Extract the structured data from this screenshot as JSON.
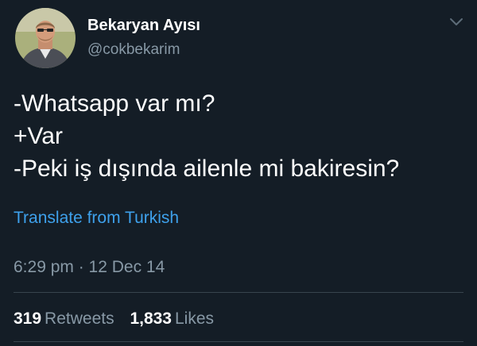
{
  "tweet": {
    "author": {
      "display_name": "Bekaryan Ayısı",
      "handle": "@cokbekarim"
    },
    "text_lines": [
      "-Whatsapp var mı?",
      "+Var",
      "-Peki iş dışında ailenle mi bakiresin?"
    ],
    "translate_label": "Translate from Turkish",
    "timestamp": "6:29 pm · 12 Dec 14",
    "stats": {
      "retweets_count": "319",
      "retweets_label": "Retweets",
      "likes_count": "1,833",
      "likes_label": "Likes"
    }
  },
  "icons": {
    "menu": "chevron-down-icon"
  },
  "colors": {
    "background": "#141d26",
    "primary_text": "#ffffff",
    "secondary_text": "#8899a6",
    "link": "#3ea1ec",
    "divider": "#38444d"
  }
}
